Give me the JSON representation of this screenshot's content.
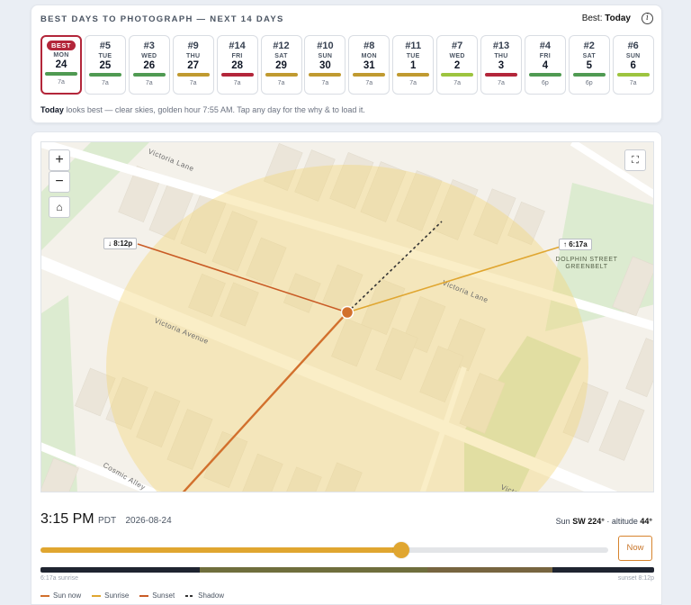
{
  "header": {
    "title": "BEST DAYS TO PHOTOGRAPH — NEXT 14 DAYS",
    "best_prefix": "Best:",
    "best_value": "Today",
    "info_glyph": "i"
  },
  "days": [
    {
      "badge": "BEST",
      "rank": "",
      "dow": "MON",
      "date": "24",
      "time": "7a",
      "color": "#4f9a52",
      "best": true
    },
    {
      "rank": "#5",
      "dow": "TUE",
      "date": "25",
      "time": "7a",
      "color": "#4f9a52"
    },
    {
      "rank": "#3",
      "dow": "WED",
      "date": "26",
      "time": "7a",
      "color": "#4f9a52"
    },
    {
      "rank": "#9",
      "dow": "THU",
      "date": "27",
      "time": "7a",
      "color": "#c09a30"
    },
    {
      "rank": "#14",
      "dow": "FRI",
      "date": "28",
      "time": "7a",
      "color": "#b3263a"
    },
    {
      "rank": "#12",
      "dow": "SAT",
      "date": "29",
      "time": "7a",
      "color": "#c09a30"
    },
    {
      "rank": "#10",
      "dow": "SUN",
      "date": "30",
      "time": "7a",
      "color": "#c09a30"
    },
    {
      "rank": "#8",
      "dow": "MON",
      "date": "31",
      "time": "7a",
      "color": "#c09a30"
    },
    {
      "rank": "#11",
      "dow": "TUE",
      "date": "1",
      "time": "7a",
      "color": "#c09a30"
    },
    {
      "rank": "#7",
      "dow": "WED",
      "date": "2",
      "time": "7a",
      "color": "#9dc43f"
    },
    {
      "rank": "#13",
      "dow": "THU",
      "date": "3",
      "time": "7a",
      "color": "#b3263a"
    },
    {
      "rank": "#4",
      "dow": "FRI",
      "date": "4",
      "time": "6p",
      "color": "#4f9a52"
    },
    {
      "rank": "#2",
      "dow": "SAT",
      "date": "5",
      "time": "6p",
      "color": "#4f9a52"
    },
    {
      "rank": "#6",
      "dow": "SUN",
      "date": "6",
      "time": "7a",
      "color": "#9dc43f"
    }
  ],
  "summary": {
    "bold": "Today",
    "text": " looks best — clear skies, golden hour 7:55 AM. Tap any day for the why & to load it."
  },
  "map": {
    "zoom_in": "+",
    "zoom_out": "−",
    "home_glyph": "⌂",
    "fullscreen_glyph": "⛶",
    "sunset_label": "↓ 8:12p",
    "sunrise_label": "↑ 6:17a",
    "streets": [
      "Victoria Lane",
      "Victoria Avenue",
      "Victoria Lane",
      "Cosmic Alley",
      "Victo"
    ],
    "park_label": [
      "DOLPHIN STREET",
      "GREENBELT"
    ]
  },
  "time": {
    "clock": "3:15 PM",
    "tz": "PDT",
    "date": "2026-08-24",
    "sun_prefix": "Sun",
    "sun_dir": "SW 224°",
    "altitude_prefix": " · altitude",
    "altitude": "44°",
    "progress": 0.636,
    "now_label": "Now"
  },
  "timeline": {
    "left_label": "6:17a sunrise",
    "right_label": "sunset 8:12p",
    "segments": [
      {
        "frac": 0.26,
        "color": "#1f2430"
      },
      {
        "frac": 0.37,
        "color": "#6f6e3d"
      },
      {
        "frac": 0.205,
        "color": "#776540"
      },
      {
        "frac": 0.165,
        "color": "#1f2430"
      }
    ]
  },
  "legend": [
    {
      "label": "Sun now",
      "color": "#d2702d",
      "dash": false
    },
    {
      "label": "Sunrise",
      "color": "#e0a630",
      "dash": false
    },
    {
      "label": "Sunset",
      "color": "#c95b25",
      "dash": false
    },
    {
      "label": "Shadow",
      "color": "#333333",
      "dash": true
    }
  ],
  "colors": {
    "accent": "#e0a630",
    "best": "#b3263a",
    "sun": "#d2702d"
  }
}
